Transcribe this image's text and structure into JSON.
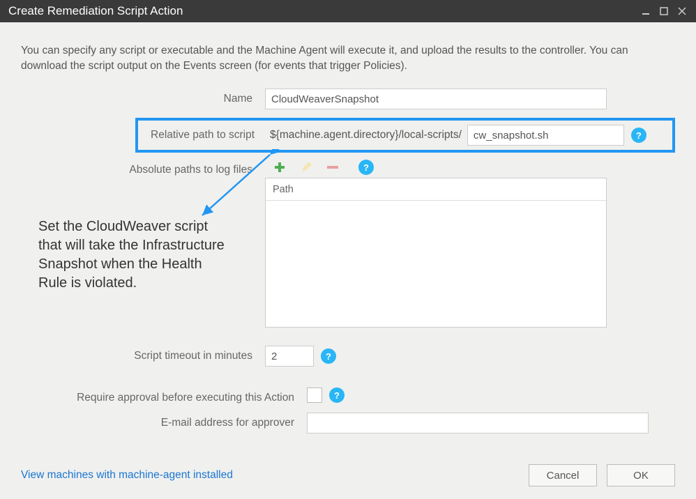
{
  "window": {
    "title": "Create Remediation Script Action"
  },
  "intro": "You can specify any script or executable and the Machine Agent will execute it, and upload the results to the controller.  You can download the script output on the Events screen (for events that trigger Policies).",
  "labels": {
    "name": "Name",
    "relative_path": "Relative path to script",
    "abs_paths": "Absolute paths to log files",
    "timeout": "Script timeout in minutes",
    "require_approval": "Require approval before executing this Action",
    "email_approver": "E-mail address for approver"
  },
  "values": {
    "name": "CloudWeaverSnapshot",
    "script_prefix": "${machine.agent.directory}/local-scripts/",
    "script_name": "cw_snapshot.sh",
    "timeout": "2",
    "require_approval": false,
    "email_approver": ""
  },
  "path_table": {
    "header": "Path",
    "rows": []
  },
  "annotation": "Set the CloudWeaver script that will take the Infrastructure Snapshot when the Health Rule is violated.",
  "footer": {
    "link": "View machines with machine-agent installed",
    "cancel": "Cancel",
    "ok": "OK"
  },
  "help_glyph": "?"
}
